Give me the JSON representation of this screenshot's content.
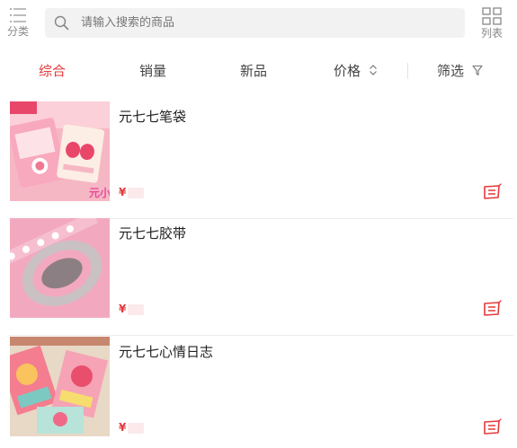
{
  "header": {
    "category_label": "分类",
    "search_placeholder": "请输入搜索的商品",
    "list_label": "列表"
  },
  "tabs": [
    {
      "label": "综合",
      "active": true
    },
    {
      "label": "销量"
    },
    {
      "label": "新品"
    },
    {
      "label": "价格",
      "icon": "sort-updown-icon"
    },
    {
      "label": "筛选",
      "icon": "filter-icon"
    }
  ],
  "products": [
    {
      "title": "元七七笔袋",
      "price_symbol": "¥",
      "image": "pencil-case-photo"
    },
    {
      "title": "元七七胶带",
      "price_symbol": "¥",
      "image": "washi-tape-photo"
    },
    {
      "title": "元七七心情日志",
      "price_symbol": "¥",
      "image": "mood-journal-photo"
    }
  ],
  "colors": {
    "accent": "#e4393c",
    "search_bg": "#f2f2f2",
    "divider": "#ececec"
  }
}
